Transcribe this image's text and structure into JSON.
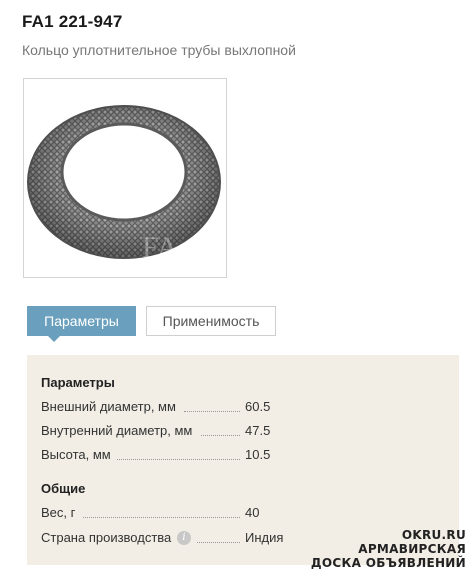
{
  "product": {
    "title": "FA1 221-947",
    "subtitle": "Кольцо уплотнительное трубы выхлопной",
    "image_logo_text": "FA"
  },
  "tabs": [
    {
      "label": "Параметры",
      "active": true
    },
    {
      "label": "Применимость",
      "active": false
    }
  ],
  "params": {
    "section_title": "Параметры",
    "rows": [
      {
        "label": "Внешний диаметр, мм",
        "value": "60.5"
      },
      {
        "label": "Внутренний диаметр, мм",
        "value": "47.5"
      },
      {
        "label": "Высота, мм",
        "value": "10.5"
      }
    ]
  },
  "general": {
    "section_title": "Общие",
    "rows": [
      {
        "label": "Вес, г",
        "value": "40"
      },
      {
        "label": "Страна производства",
        "value": "Индия",
        "icon": "info-icon"
      }
    ]
  },
  "watermark": {
    "line1": "OKRU.RU",
    "line2": "АРМАВИРСКАЯ",
    "line3": "ДОСКА ОБЪЯВЛЕНИЙ"
  },
  "colors": {
    "tab_active": "#6aa0bd",
    "panel_bg": "#f2ede5"
  }
}
